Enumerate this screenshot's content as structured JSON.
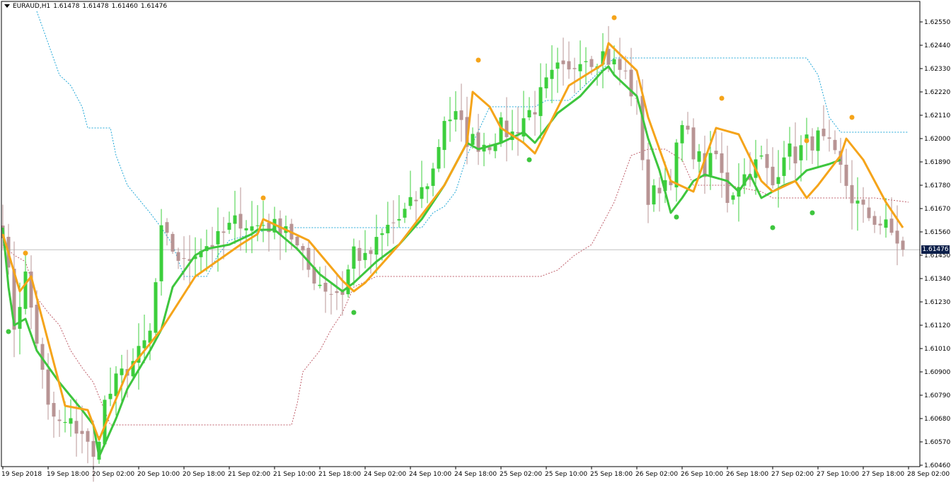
{
  "header": {
    "symbol": "EURAUD,H1",
    "ohlc": [
      "1.61478",
      "1.61478",
      "1.61460",
      "1.61476"
    ]
  },
  "current_price": "1.61476",
  "colors": {
    "bull": "#3ccf3c",
    "bear": "#b89494",
    "fast_line": "#f5a41a",
    "slow_line": "#3ec63e",
    "upper_channel": "#22a8d8",
    "lower_channel": "#c0606c",
    "price_line": "#c0c0c0",
    "axis": "#000000",
    "badge": "#0b1f4a"
  },
  "chart_data": {
    "type": "candlestick",
    "symbol": "EURAUD",
    "timeframe": "H1",
    "ylim": [
      1.6046,
      1.626
    ],
    "y_ticks": [
      "1.62550",
      "1.62440",
      "1.62330",
      "1.62220",
      "1.62110",
      "1.62000",
      "1.61890",
      "1.61780",
      "1.61670",
      "1.61560",
      "1.61450",
      "1.61340",
      "1.61230",
      "1.61120",
      "1.61010",
      "1.60900",
      "1.60790",
      "1.60680",
      "1.60570",
      "1.60460"
    ],
    "x_ticks": [
      "19 Sep 2018",
      "19 Sep 18:00",
      "20 Sep 02:00",
      "20 Sep 10:00",
      "20 Sep 18:00",
      "21 Sep 02:00",
      "21 Sep 10:00",
      "21 Sep 18:00",
      "24 Sep 02:00",
      "24 Sep 10:00",
      "24 Sep 18:00",
      "25 Sep 02:00",
      "25 Sep 10:00",
      "25 Sep 18:00",
      "26 Sep 02:00",
      "26 Sep 10:00",
      "26 Sep 18:00",
      "27 Sep 02:00",
      "27 Sep 10:00",
      "27 Sep 18:00",
      "28 Sep 02:00"
    ],
    "x_tick_index": [
      0,
      8,
      16,
      24,
      32,
      40,
      48,
      56,
      64,
      72,
      80,
      88,
      96,
      104,
      112,
      120,
      128,
      136,
      144,
      152,
      160
    ],
    "anchors": [
      [
        0,
        1.6158
      ],
      [
        2,
        1.6112
      ],
      [
        4,
        1.6135
      ],
      [
        6,
        1.6105
      ],
      [
        8,
        1.6072
      ],
      [
        10,
        1.6065
      ],
      [
        12,
        1.6065
      ],
      [
        14,
        1.6062
      ],
      [
        16,
        1.6048
      ],
      [
        18,
        1.6075
      ],
      [
        20,
        1.6085
      ],
      [
        22,
        1.6092
      ],
      [
        24,
        1.6098
      ],
      [
        26,
        1.6108
      ],
      [
        28,
        1.6155
      ],
      [
        30,
        1.6148
      ],
      [
        32,
        1.614
      ],
      [
        34,
        1.6148
      ],
      [
        36,
        1.615
      ],
      [
        38,
        1.6152
      ],
      [
        40,
        1.6158
      ],
      [
        42,
        1.6162
      ],
      [
        44,
        1.6158
      ],
      [
        46,
        1.616
      ],
      [
        48,
        1.6158
      ],
      [
        50,
        1.616
      ],
      [
        52,
        1.6148
      ],
      [
        54,
        1.6138
      ],
      [
        56,
        1.6132
      ],
      [
        58,
        1.6128
      ],
      [
        60,
        1.6128
      ],
      [
        62,
        1.6148
      ],
      [
        64,
        1.6142
      ],
      [
        66,
        1.615
      ],
      [
        68,
        1.6158
      ],
      [
        70,
        1.6162
      ],
      [
        72,
        1.6168
      ],
      [
        74,
        1.6175
      ],
      [
        76,
        1.6185
      ],
      [
        78,
        1.621
      ],
      [
        80,
        1.621
      ],
      [
        82,
        1.62
      ],
      [
        84,
        1.6198
      ],
      [
        86,
        1.6198
      ],
      [
        88,
        1.6205
      ],
      [
        90,
        1.6202
      ],
      [
        92,
        1.621
      ],
      [
        94,
        1.6215
      ],
      [
        96,
        1.6225
      ],
      [
        98,
        1.6232
      ],
      [
        100,
        1.623
      ],
      [
        102,
        1.624
      ],
      [
        104,
        1.6238
      ],
      [
        106,
        1.624
      ],
      [
        108,
        1.6235
      ],
      [
        110,
        1.623
      ],
      [
        112,
        1.6215
      ],
      [
        114,
        1.617
      ],
      [
        116,
        1.6178
      ],
      [
        118,
        1.6183
      ],
      [
        120,
        1.6205
      ],
      [
        122,
        1.6195
      ],
      [
        124,
        1.6185
      ],
      [
        126,
        1.6192
      ],
      [
        128,
        1.6172
      ],
      [
        130,
        1.618
      ],
      [
        132,
        1.6185
      ],
      [
        134,
        1.619
      ],
      [
        136,
        1.6178
      ],
      [
        138,
        1.6195
      ],
      [
        140,
        1.6192
      ],
      [
        142,
        1.6198
      ],
      [
        144,
        1.62
      ],
      [
        146,
        1.6195
      ],
      [
        148,
        1.6185
      ],
      [
        150,
        1.6172
      ],
      [
        152,
        1.6165
      ],
      [
        154,
        1.6162
      ],
      [
        156,
        1.6158
      ],
      [
        158,
        1.6152
      ],
      [
        159,
        1.61476
      ]
    ],
    "fast_line": [
      [
        0,
        1.6155
      ],
      [
        3,
        1.6128
      ],
      [
        5,
        1.6135
      ],
      [
        11,
        1.6074
      ],
      [
        15,
        1.6072
      ],
      [
        17,
        1.6058
      ],
      [
        22,
        1.609
      ],
      [
        28,
        1.611
      ],
      [
        34,
        1.6135
      ],
      [
        42,
        1.615
      ],
      [
        45,
        1.6155
      ],
      [
        46,
        1.6162
      ],
      [
        50,
        1.6157
      ],
      [
        54,
        1.6152
      ],
      [
        60,
        1.6133
      ],
      [
        62,
        1.6128
      ],
      [
        64,
        1.6132
      ],
      [
        70,
        1.615
      ],
      [
        78,
        1.6178
      ],
      [
        82,
        1.6198
      ],
      [
        83,
        1.6222
      ],
      [
        86,
        1.6215
      ],
      [
        88,
        1.6205
      ],
      [
        92,
        1.6198
      ],
      [
        94,
        1.6193
      ],
      [
        100,
        1.6225
      ],
      [
        106,
        1.6235
      ],
      [
        107,
        1.6245
      ],
      [
        112,
        1.6232
      ],
      [
        114,
        1.621
      ],
      [
        118,
        1.618
      ],
      [
        122,
        1.6175
      ],
      [
        126,
        1.6205
      ],
      [
        130,
        1.6202
      ],
      [
        134,
        1.618
      ],
      [
        136,
        1.6175
      ],
      [
        140,
        1.618
      ],
      [
        142,
        1.6172
      ],
      [
        144,
        1.6178
      ],
      [
        148,
        1.6192
      ],
      [
        149,
        1.62
      ],
      [
        152,
        1.619
      ],
      [
        156,
        1.617
      ],
      [
        159,
        1.6158
      ]
    ],
    "slow_line": [
      [
        0,
        1.6158
      ],
      [
        1,
        1.613
      ],
      [
        2,
        1.6112
      ],
      [
        4,
        1.6115
      ],
      [
        6,
        1.61
      ],
      [
        10,
        1.6085
      ],
      [
        14,
        1.6072
      ],
      [
        16,
        1.6065
      ],
      [
        17,
        1.605
      ],
      [
        20,
        1.6068
      ],
      [
        22,
        1.6082
      ],
      [
        26,
        1.61
      ],
      [
        28,
        1.611
      ],
      [
        30,
        1.613
      ],
      [
        34,
        1.6145
      ],
      [
        36,
        1.6148
      ],
      [
        40,
        1.615
      ],
      [
        44,
        1.6155
      ],
      [
        45,
        1.6157
      ],
      [
        48,
        1.6157
      ],
      [
        52,
        1.6148
      ],
      [
        56,
        1.6136
      ],
      [
        60,
        1.6128
      ],
      [
        62,
        1.6132
      ],
      [
        66,
        1.6142
      ],
      [
        70,
        1.615
      ],
      [
        74,
        1.6162
      ],
      [
        78,
        1.6178
      ],
      [
        82,
        1.6198
      ],
      [
        84,
        1.6195
      ],
      [
        88,
        1.6198
      ],
      [
        92,
        1.6203
      ],
      [
        94,
        1.6198
      ],
      [
        98,
        1.6212
      ],
      [
        102,
        1.622
      ],
      [
        106,
        1.6232
      ],
      [
        107,
        1.6234
      ],
      [
        108,
        1.623
      ],
      [
        112,
        1.622
      ],
      [
        114,
        1.62
      ],
      [
        116,
        1.6185
      ],
      [
        118,
        1.6165
      ],
      [
        120,
        1.6172
      ],
      [
        122,
        1.618
      ],
      [
        124,
        1.6183
      ],
      [
        128,
        1.618
      ],
      [
        130,
        1.6175
      ],
      [
        132,
        1.6183
      ],
      [
        134,
        1.6172
      ],
      [
        136,
        1.6175
      ],
      [
        138,
        1.6178
      ],
      [
        140,
        1.618
      ],
      [
        142,
        1.6185
      ],
      [
        146,
        1.6188
      ],
      [
        148,
        1.619
      ]
    ],
    "upper_channel": [
      [
        6,
        1.626
      ],
      [
        10,
        1.623
      ],
      [
        12,
        1.6225
      ],
      [
        14,
        1.6215
      ],
      [
        15,
        1.6205
      ],
      [
        19,
        1.6205
      ],
      [
        20,
        1.6192
      ],
      [
        22,
        1.6178
      ],
      [
        26,
        1.6165
      ],
      [
        28,
        1.6158
      ],
      [
        30,
        1.615
      ],
      [
        32,
        1.6135
      ],
      [
        36,
        1.6135
      ],
      [
        38,
        1.6145
      ],
      [
        40,
        1.6152
      ],
      [
        48,
        1.6158
      ],
      [
        74,
        1.6158
      ],
      [
        76,
        1.6165
      ],
      [
        78,
        1.6168
      ],
      [
        80,
        1.6175
      ],
      [
        82,
        1.6192
      ],
      [
        86,
        1.6215
      ],
      [
        94,
        1.6215
      ],
      [
        96,
        1.6218
      ],
      [
        100,
        1.6218
      ],
      [
        104,
        1.6228
      ],
      [
        108,
        1.6238
      ],
      [
        110,
        1.6238
      ],
      [
        142,
        1.6238
      ],
      [
        144,
        1.623
      ],
      [
        146,
        1.621
      ],
      [
        148,
        1.6203
      ],
      [
        160,
        1.6203
      ]
    ],
    "lower_channel": [
      [
        0,
        1.615
      ],
      [
        2,
        1.6145
      ],
      [
        4,
        1.6142
      ],
      [
        6,
        1.6125
      ],
      [
        8,
        1.6118
      ],
      [
        10,
        1.6112
      ],
      [
        12,
        1.61
      ],
      [
        14,
        1.6092
      ],
      [
        16,
        1.6085
      ],
      [
        19,
        1.6065
      ],
      [
        51,
        1.6065
      ],
      [
        52,
        1.6075
      ],
      [
        53,
        1.609
      ],
      [
        56,
        1.61
      ],
      [
        58,
        1.611
      ],
      [
        60,
        1.6118
      ],
      [
        62,
        1.613
      ],
      [
        66,
        1.6135
      ],
      [
        95,
        1.6135
      ],
      [
        98,
        1.6138
      ],
      [
        101,
        1.6145
      ],
      [
        104,
        1.615
      ],
      [
        106,
        1.616
      ],
      [
        108,
        1.617
      ],
      [
        111,
        1.6192
      ],
      [
        114,
        1.6195
      ],
      [
        117,
        1.6195
      ],
      [
        120,
        1.619
      ],
      [
        122,
        1.6178
      ],
      [
        128,
        1.6178
      ],
      [
        134,
        1.6175
      ],
      [
        136,
        1.6172
      ],
      [
        148,
        1.6172
      ],
      [
        154,
        1.6172
      ],
      [
        160,
        1.617
      ]
    ],
    "markers_high": [
      [
        4,
        1.6146
      ],
      [
        46,
        1.6172
      ],
      [
        84,
        1.6237
      ],
      [
        108,
        1.6257
      ],
      [
        127,
        1.6219
      ],
      [
        142,
        1.6199
      ],
      [
        150,
        1.621
      ]
    ],
    "markers_low": [
      [
        1,
        1.6109
      ],
      [
        62,
        1.6118
      ],
      [
        93,
        1.619
      ],
      [
        119,
        1.6163
      ],
      [
        136,
        1.6158
      ],
      [
        143,
        1.6165
      ]
    ]
  }
}
